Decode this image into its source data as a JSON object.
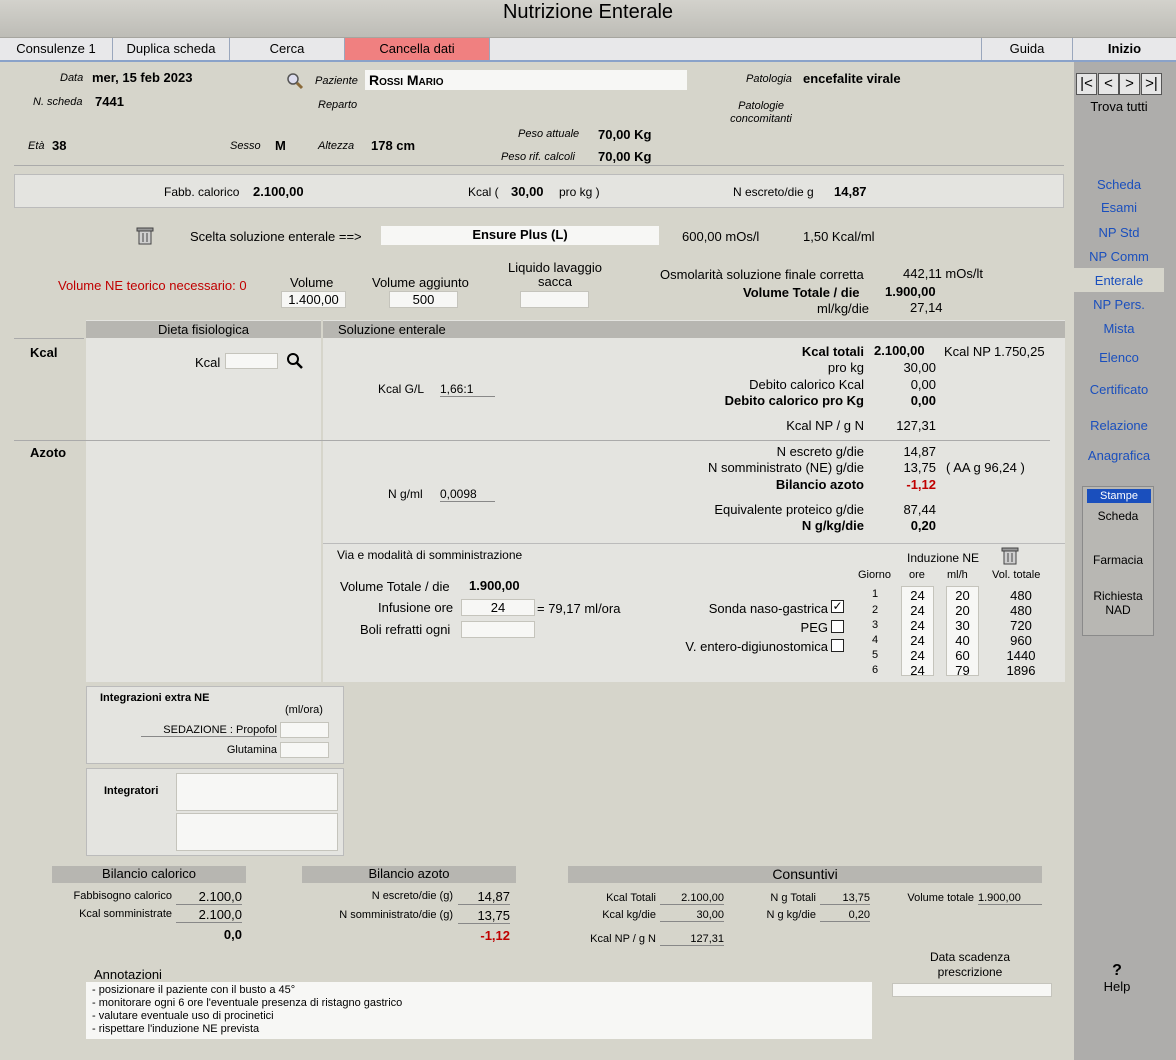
{
  "window": {
    "title": "Nutrizione  Enterale"
  },
  "menu": {
    "consulenze": "Consulenze 1",
    "duplica": "Duplica scheda",
    "cerca": "Cerca",
    "cancella": "Cancella dati",
    "guida": "Guida",
    "inizio": "Inizio"
  },
  "colors": {
    "accent": "#1a4fbd",
    "cancel_bg": "#f08080",
    "negative": "#c00000",
    "stampe_bg": "#1a4fbd"
  },
  "header": {
    "data_label": "Data",
    "data_value": "mer, 15 feb 2023",
    "nscheda_label": "N. scheda",
    "nscheda_value": "7441",
    "paziente_label": "Paziente",
    "paziente_value": "Rossi Mario",
    "reparto_label": "Reparto",
    "patologia_label": "Patologia",
    "patologia_value": "encefalite virale",
    "patologie_conc_label": "Patologie concomitanti",
    "eta_label": "Età",
    "eta_value": "38",
    "sesso_label": "Sesso",
    "sesso_value": "M",
    "altezza_label": "Altezza",
    "altezza_value": "178 cm",
    "peso_attuale_label": "Peso attuale",
    "peso_attuale_value": "70,00 Kg",
    "peso_rif_label": "Peso rif. calcoli",
    "peso_rif_value": "70,00 Kg"
  },
  "fabb": {
    "label": "Fabb. calorico",
    "value": "2.100,00",
    "kcal_label": "Kcal (",
    "kcal_value": "30,00",
    "kcal_unit": "pro kg )",
    "n_label": "N escreto/die g",
    "n_value": "14,87"
  },
  "soluzione": {
    "label": "Scelta soluzione enterale ==>",
    "value": "Ensure Plus (L)",
    "mos": "600,00 mOs/l",
    "kcal": "1,50 Kcal/ml"
  },
  "volumi": {
    "teorico": "Volume NE teorico necessario: 0",
    "volume_label": "Volume",
    "volume_value": "1.400,00",
    "aggiunto_label": "Volume aggiunto",
    "aggiunto_value": "500",
    "liquido_label": "Liquido lavaggio sacca",
    "osm_label": "Osmolarità soluzione finale corretta",
    "osm_value": "442,11 mOs/lt",
    "vt_label": "Volume Totale / die",
    "vt_value": "1.900,00",
    "mlkg_label": "ml/kg/die",
    "mlkg_value": "27,14"
  },
  "dieta": {
    "header": "Dieta fisiologica",
    "kcal_side": "Kcal",
    "kcal_label": "Kcal",
    "azoto_side": "Azoto"
  },
  "sol": {
    "header": "Soluzione enterale",
    "kcalgl_label": "Kcal G/L",
    "kcalgl_value": "1,66:1",
    "ngml_label": "N g/ml",
    "ngml_value": "0,0098",
    "kcal_tot_label": "Kcal totali",
    "kcal_tot_value": "2.100,00",
    "kcal_np_label": "Kcal NP",
    "kcal_np_value": "1.750,25",
    "prokg_label": "pro kg",
    "prokg_value": "30,00",
    "deb_label": "Debito calorico Kcal",
    "deb_value": "0,00",
    "debkg_label": "Debito calorico pro Kg",
    "debkg_value": "0,00",
    "kcalnpn_label": "Kcal NP / g N",
    "kcalnpn_value": "127,31",
    "nesc_label": "N  escreto g/die",
    "nesc_value": "14,87",
    "nsom_label": "N somministrato (NE) g/die",
    "nsom_value": "13,75",
    "aa": "( AA g 96,24 )",
    "bil_label": "Bilancio azoto",
    "bil_value": "-1,12",
    "eqp_label": "Equivalente proteico g/die",
    "eqp_value": "87,44",
    "ngkg_label": "N g/kg/die",
    "ngkg_value": "0,20"
  },
  "via": {
    "header": "Via e modalità di somministrazione",
    "vt_label": "Volume Totale / die",
    "vt_value": "1.900,00",
    "inf_label": "Infusione ore",
    "inf_value": "24",
    "inf_rate": "= 79,17 ml/ora",
    "boli_label": "Boli refratti ogni",
    "sonda": "Sonda naso-gastrica",
    "peg": "PEG",
    "ved": "V. entero-digiunostomica",
    "check": "✓",
    "ind_label": "Induzione NE",
    "col_giorno": "Giorno",
    "col_ore": "ore",
    "col_mlh": "ml/h",
    "col_vol": "Vol. totale",
    "rows": [
      {
        "g": "1",
        "ore": "24",
        "mlh": "20",
        "vol": "480"
      },
      {
        "g": "2",
        "ore": "24",
        "mlh": "20",
        "vol": "480"
      },
      {
        "g": "3",
        "ore": "24",
        "mlh": "30",
        "vol": "720"
      },
      {
        "g": "4",
        "ore": "24",
        "mlh": "40",
        "vol": "960"
      },
      {
        "g": "5",
        "ore": "24",
        "mlh": "60",
        "vol": "1440"
      },
      {
        "g": "6",
        "ore": "24",
        "mlh": "79",
        "vol": "1896"
      }
    ]
  },
  "integr": {
    "title": "Integrazioni extra NE",
    "unit": "(ml/ora)",
    "sed": "SEDAZIONE : Propofol",
    "glut": "Glutamina",
    "integratori": "Integratori"
  },
  "bilcal": {
    "header": "Bilancio calorico",
    "fab_label": "Fabbisogno calorico",
    "fab_value": "2.100,0",
    "som_label": "Kcal somministrate",
    "som_value": "2.100,0",
    "tot": "0,0"
  },
  "bilaz": {
    "header": "Bilancio azoto",
    "nesc_label": "N escreto/die (g)",
    "nesc_value": "14,87",
    "nsom_label": "N somministrato/die (g)",
    "nsom_value": "13,75",
    "tot": "-1,12"
  },
  "cons": {
    "header": "Consuntivi",
    "kt_label": "Kcal Totali",
    "kt_value": "2.100,00",
    "kkg_label": "Kcal kg/die",
    "kkg_value": "30,00",
    "knp_label": "Kcal NP / g N",
    "knp_value": "127,31",
    "ngt_label": "N g Totali",
    "ngt_value": "13,75",
    "ngkg_label": "N g kg/die",
    "ngkg_value": "0,20",
    "vt_label": "Volume totale",
    "vt_value": "1.900,00"
  },
  "annot": {
    "label": "Annotazioni",
    "lines": [
      "- posizionare il paziente con il busto a 45°",
      "- monitorare ogni 6 ore l'eventuale presenza di ristagno gastrico",
      "- valutare eventuale uso di procinetici",
      "- rispettare l'induzione NE prevista"
    ]
  },
  "scadenza": {
    "label": "Data scadenza prescrizione"
  },
  "sidebar": {
    "trova": "Trova tutti",
    "scheda": "Scheda",
    "esami": "Esami",
    "npstd": "NP Std",
    "npcomm": "NP Comm",
    "enterale": "Enterale",
    "nppers": "NP Pers.",
    "mista": "Mista",
    "elenco": "Elenco",
    "certificato": "Certificato",
    "relazione": "Relazione",
    "anagrafica": "Anagrafica",
    "stampe": "Stampe",
    "st_scheda": "Scheda",
    "st_farmacia": "Farmacia",
    "st_nad": "Richiesta NAD",
    "help_q": "?",
    "help": "Help",
    "nav": [
      "|<",
      "<",
      ">",
      ">|"
    ]
  }
}
